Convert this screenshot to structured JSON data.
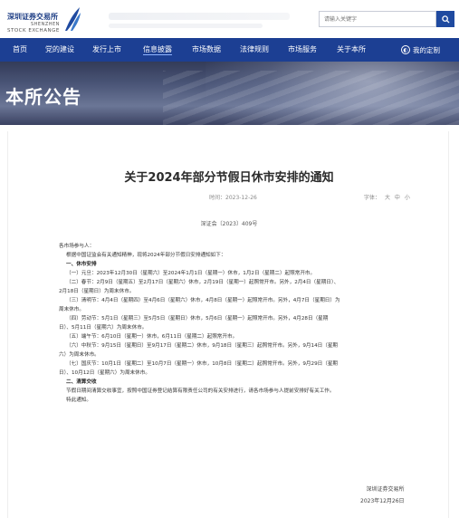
{
  "header": {
    "logo_cn": "深圳证券交易所",
    "logo_en_line1": "SHENZHEN",
    "logo_en_line2": "STOCK EXCHANGE",
    "search_placeholder": "请输入关键字"
  },
  "nav": {
    "items": [
      {
        "label": "首页"
      },
      {
        "label": "党的建设"
      },
      {
        "label": "发行上市"
      },
      {
        "label": "信息披露"
      },
      {
        "label": "市场数据"
      },
      {
        "label": "法律规则"
      },
      {
        "label": "市场服务"
      },
      {
        "label": "关于本所"
      }
    ],
    "active": "信息披露",
    "custom_label": "我的定制"
  },
  "banner": {
    "title": "本所公告"
  },
  "article": {
    "title": "关于2024年部分节假日休市安排的通知",
    "time": "时间：2023-12-26",
    "font_label": "字体：",
    "font_large": "大",
    "font_medium": "中",
    "font_small": "小",
    "doc_number": "深证会〔2023〕409号",
    "lines": [
      {
        "text": "各市场参与人：",
        "style": "indent1"
      },
      {
        "text": "根据中国证监会有关通知精神，现将2024年部分节假日安排通知如下：",
        "style": "indent2"
      },
      {
        "text": "一、休市安排",
        "style": "heading"
      },
      {
        "text": "（一）元旦：2023年12月30日（星期六）至2024年1月1日（星期一）休市，1月2日（星期二）起照常开市。",
        "style": "indent2"
      },
      {
        "text": "（二）春节：2月9日（星期五）至2月17日（星期六）休市，2月19日（星期一）起照常开市。另外，2月4日（星期日）、",
        "style": "indent2"
      },
      {
        "text": "2月18日（星期日）为周末休市。",
        "style": "indent1"
      },
      {
        "text": "（三）清明节：4月4日（星期四）至4月6日（星期六）休市，4月8日（星期一）起照常开市。另外，4月7日（星期日）为",
        "style": "indent2"
      },
      {
        "text": "周末休市。",
        "style": "indent1"
      },
      {
        "text": "（四）劳动节：5月1日（星期三）至5月5日（星期日）休市，5月6日（星期一）起照常开市。另外，4月28日（星期",
        "style": "indent2"
      },
      {
        "text": "日）、5月11日（星期六）为周末休市。",
        "style": "indent1"
      },
      {
        "text": "（五）端午节：6月10日（星期一）休市，6月11日（星期二）起照常开市。",
        "style": "indent2"
      },
      {
        "text": "（六）中秋节：9月15日（星期日）至9月17日（星期二）休市，9月18日（星期三）起照常开市。另外，9月14日（星期",
        "style": "indent2"
      },
      {
        "text": "六）为周末休市。",
        "style": "indent1"
      },
      {
        "text": "（七）国庆节：10月1日（星期二）至10月7日（星期一）休市，10月8日（星期二）起照常开市。另外，9月29日（星期",
        "style": "indent2"
      },
      {
        "text": "日）、10月12日（星期六）为周末休市。",
        "style": "indent1"
      },
      {
        "text": "二、清算交收",
        "style": "heading"
      },
      {
        "text": "节假日期间清算交收事宜，按照中国证券登记结算有限责任公司的有关安排进行，请各市场参与人提前安排好有关工作。",
        "style": "indent2"
      },
      {
        "text": "特此通知。",
        "style": "indent2"
      }
    ],
    "signature_org": "深圳证券交易所",
    "signature_date": "2023年12月26日"
  },
  "colors": {
    "nav_bg": "#1c3f93",
    "brand_blue": "#1f4aa0"
  }
}
